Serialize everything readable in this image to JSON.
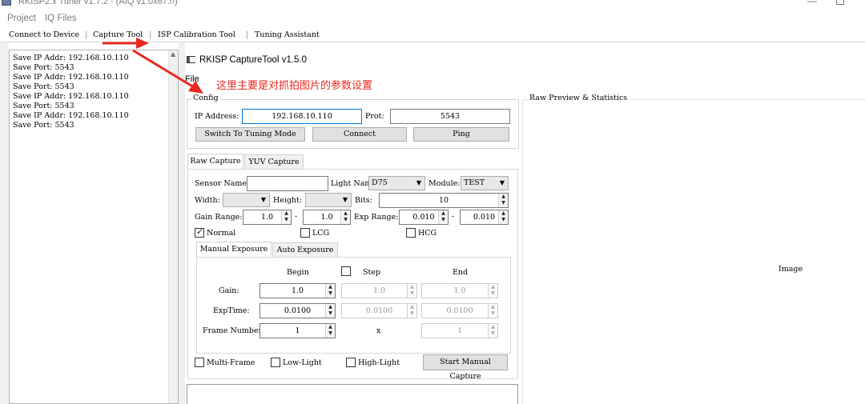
{
  "titlebar": {
    "title": "RKISP2.x Tuner v1.7.2 - (AIQ v1.0x67.h)"
  },
  "menubar": {
    "items": [
      "Project",
      "IQ Files"
    ]
  },
  "toolbar": {
    "items": [
      "Connect to Device",
      "Capture Tool",
      "ISP Calibration Tool",
      "Tuning Assistant"
    ]
  },
  "log": {
    "lines": [
      "Save IP Addr: 192.168.10.110",
      "Save Port: 5543",
      "Save IP Addr: 192.168.10.110",
      "Save Port: 5543",
      "Save IP Addr: 192.168.10.110",
      "Save Port: 5543",
      "Save IP Addr: 192.168.10.110",
      "Save Port: 5543"
    ]
  },
  "capture_window": {
    "title": "RKISP CaptureTool v1.5.0",
    "file_menu": "File",
    "annotation": "这里主要是对抓拍图片的参数设置",
    "config": {
      "title": "Config",
      "ip_label": "IP Address:",
      "ip_value": "192.168.10.110",
      "port_label": "Prot:",
      "port_value": "5543",
      "switch_button": "Switch To Tuning Mode",
      "connect_button": "Connect",
      "ping_button": "Ping"
    },
    "tabs": [
      "Raw Capture",
      "YUV Capture"
    ],
    "raw": {
      "sensor_name_label": "Sensor Name:",
      "sensor_name_value": "",
      "light_name_label": "Light Name:",
      "light_name_value": "D75",
      "module_label": "Module:",
      "module_value": "TEST",
      "width_label": "Width:",
      "height_label": "Height:",
      "bits_label": "Bits:",
      "bits_value": "10",
      "gain_range_label": "Gain Range:",
      "gain_min": "1.0",
      "gain_max": "1.0",
      "range_dash": "-",
      "exp_range_label": "Exp Range:",
      "exp_min": "0.010",
      "exp_max": "0.010",
      "normal_label": "Normal",
      "lcg_label": "LCG",
      "hcg_label": "HCG"
    },
    "exposure_tabs": [
      "Manual Exposure",
      "Auto Exposure"
    ],
    "manual": {
      "begin_header": "Begin",
      "step_header": "Step",
      "end_header": "End",
      "gain_label": "Gain:",
      "gain_begin": "1.0",
      "gain_step": "1.0",
      "gain_end": "1.0",
      "exptime_label": "ExpTime:",
      "exp_begin": "0.0100",
      "exp_step": "0.0100",
      "exp_end": "0.0100",
      "frame_label": "Frame Number:",
      "frame_begin": "1",
      "frame_x": "x",
      "frame_end": "1"
    },
    "bottom": {
      "multi_frame": "Multi-Frame",
      "low_light": "Low-Light",
      "high_light": "High-Light",
      "start_button": "Start Manual Capture"
    },
    "preview": {
      "title": "Raw Preview & Statistics",
      "image_label": "Image"
    }
  }
}
